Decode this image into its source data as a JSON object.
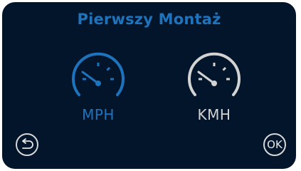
{
  "title": "Pierwszy Montaż",
  "options": [
    {
      "label": "MPH",
      "selected": true,
      "color": "#1e73bd"
    },
    {
      "label": "KMH",
      "selected": false,
      "color": "#d3d3d3"
    }
  ],
  "buttons": {
    "back_icon": "back-arrow-icon",
    "ok_label": "OK"
  },
  "colors": {
    "background": "#03152b",
    "accent": "#1e73bd",
    "inactive": "#d3d3d3"
  }
}
